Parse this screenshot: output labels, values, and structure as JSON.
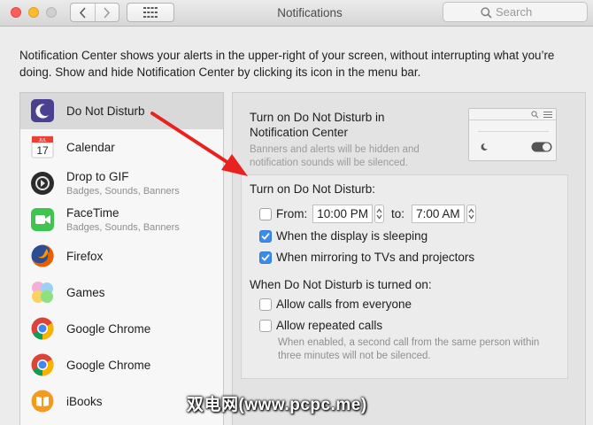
{
  "window": {
    "title": "Notifications",
    "search_placeholder": "Search"
  },
  "intro": "Notification Center shows your alerts in the upper-right of your screen, without interrupting what you’re doing. Show and hide Notification Center by clicking its icon in the menu bar.",
  "apps": [
    {
      "name": "Do Not Disturb",
      "sub": "",
      "icon": "moon-icon",
      "selected": true
    },
    {
      "name": "Calendar",
      "sub": "",
      "icon": "calendar-icon",
      "date": "17",
      "month": "JUL"
    },
    {
      "name": "Drop to GIF",
      "sub": "Badges, Sounds, Banners",
      "icon": "drop-to-gif-icon"
    },
    {
      "name": "FaceTime",
      "sub": "Badges, Sounds, Banners",
      "icon": "facetime-icon"
    },
    {
      "name": "Firefox",
      "sub": "",
      "icon": "firefox-icon"
    },
    {
      "name": "Games",
      "sub": "",
      "icon": "games-icon"
    },
    {
      "name": "Google Chrome",
      "sub": "",
      "icon": "chrome-icon"
    },
    {
      "name": "Google Chrome",
      "sub": "",
      "icon": "chrome-icon"
    },
    {
      "name": "iBooks",
      "sub": "",
      "icon": "ibooks-icon"
    }
  ],
  "detail": {
    "heading": "Turn on Do Not Disturb in Notification Center",
    "subtext": "Banners and alerts will be hidden and notification sounds will be silenced.",
    "dnd_label": "Turn on Do Not Disturb:",
    "from_label": "From:",
    "from_time": "10:00 PM",
    "to_label": "to:",
    "to_time": "7:00 AM",
    "from_checked": false,
    "display_sleeping_label": "When the display is sleeping",
    "display_sleeping_checked": true,
    "mirroring_label": "When mirroring to TVs and projectors",
    "mirroring_checked": true,
    "when_on_label": "When Do Not Disturb is turned on:",
    "allow_calls_label": "Allow calls from everyone",
    "allow_calls_checked": false,
    "allow_repeated_label": "Allow repeated calls",
    "allow_repeated_checked": false,
    "note": "When enabled, a second call from the same person within three minutes will not be silenced."
  },
  "watermark": "双电网(www.pcpc.me)",
  "colors": {
    "accent": "#3b8ce8",
    "arrow": "#e8231f",
    "selected_row": "#d9d9d9"
  }
}
